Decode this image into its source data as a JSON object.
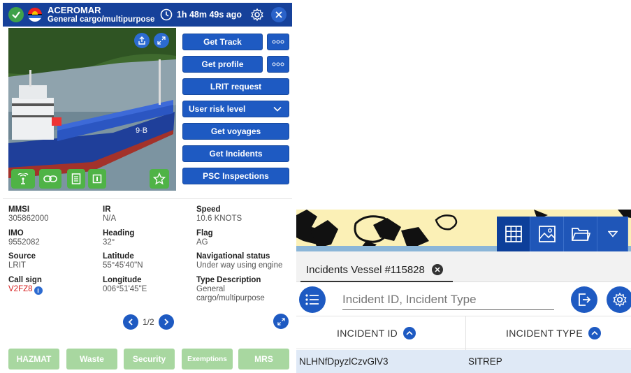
{
  "vessel": {
    "name": "ACEROMAR",
    "type": "General cargo/multipurpose",
    "last_seen": "1h 48m 49s ago"
  },
  "actions": {
    "get_track": "Get Track",
    "get_profile": "Get profile",
    "lrit_request": "LRIT request",
    "user_risk_level": "User risk level",
    "get_voyages": "Get voyages",
    "get_incidents": "Get Incidents",
    "psc_inspections": "PSC Inspections"
  },
  "details": {
    "mmsi": {
      "label": "MMSI",
      "value": "305862000"
    },
    "ir": {
      "label": "IR",
      "value": "N/A"
    },
    "speed": {
      "label": "Speed",
      "value": "10.6 KNOTS"
    },
    "imo": {
      "label": "IMO",
      "value": "9552082"
    },
    "heading": {
      "label": "Heading",
      "value": "32°"
    },
    "flag": {
      "label": "Flag",
      "value": "AG"
    },
    "source": {
      "label": "Source",
      "value": "LRIT"
    },
    "latitude": {
      "label": "Latitude",
      "value": "55°45'40\"N"
    },
    "nav_status": {
      "label": "Navigational status",
      "value": "Under way using engine"
    },
    "call_sign": {
      "label": "Call sign",
      "value": "V2FZ8"
    },
    "longitude": {
      "label": "Longitude",
      "value": "006°51'45\"E"
    },
    "type_description": {
      "label": "Type Description",
      "value_line1": "General",
      "value_line2": "cargo/multipurpose"
    }
  },
  "pager": {
    "text": "1/2"
  },
  "footer_buttons": {
    "hazmat": "HAZMAT",
    "waste": "Waste",
    "security": "Security",
    "exemptions": "Exemptions",
    "mrs": "MRS"
  },
  "incidents": {
    "tab_label": "Incidents Vessel #115828",
    "search_placeholder": "Incident ID, Incident Type",
    "columns": [
      "INCIDENT ID",
      "INCIDENT TYPE"
    ],
    "rows": [
      {
        "id": "NLHNfDpyzlCzvGlV3",
        "type": "SITREP"
      }
    ]
  },
  "colors": {
    "primary": "#1e5ac2",
    "header": "#16419a",
    "green": "#4fb346",
    "footer_green": "#a8d7a0",
    "alert_red": "#d62020"
  }
}
